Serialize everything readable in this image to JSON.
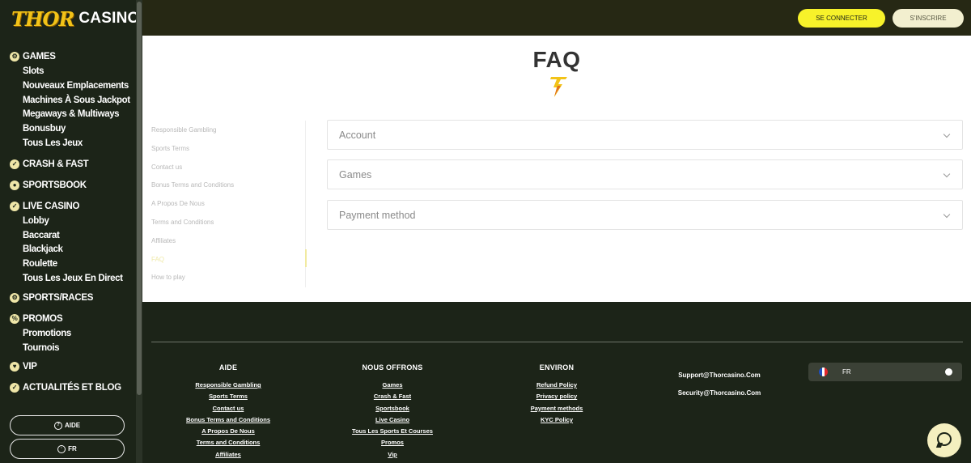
{
  "brand": {
    "thor": "THOR",
    "casino": "CASINO"
  },
  "sidebar": {
    "games": {
      "label": "GAMES",
      "items": [
        "Slots",
        "Nouveaux Emplacements",
        "Machines À Sous Jackpot",
        "Megaways & Multiways",
        "Bonusbuy",
        "Tous Les Jeux"
      ]
    },
    "crash": {
      "label": "CRASH & FAST"
    },
    "sportsbook": {
      "label": "SPORTSBOOK"
    },
    "live": {
      "label": "LIVE CASINO",
      "items": [
        "Lobby",
        "Baccarat",
        "Blackjack",
        "Roulette",
        "Tous Les Jeux En Direct"
      ]
    },
    "sportsraces": {
      "label": "SPORTS/RACES"
    },
    "promos": {
      "label": "PROMOS",
      "items": [
        "Promotions",
        "Tournois"
      ]
    },
    "vip": {
      "label": "VIP"
    },
    "news": {
      "label": "ACTUALITÉS ET BLOG"
    },
    "help_label": "AIDE",
    "lang_label": "FR"
  },
  "topbar": {
    "login_label": "SE CONNECTER",
    "register_label": "S'INSCRIRE"
  },
  "main": {
    "title": "FAQ",
    "menu": [
      "Responsible Gambling",
      "Sports Terms",
      "Contact us",
      "Bonus Terms and Conditions",
      "A Propos De Nous",
      "Terms and Conditions",
      "Affiliates",
      "FAQ",
      "How to play"
    ],
    "accordion": [
      "Account",
      "Games",
      "Payment method"
    ]
  },
  "footer": {
    "aide": {
      "title": "AIDE",
      "links": [
        "Responsible Gambling",
        "Sports Terms",
        "Contact us",
        "Bonus Terms and Conditions",
        "A Propos De Nous",
        "Terms and Conditions",
        "Affiliates"
      ]
    },
    "offrons": {
      "title": "NOUS OFFRONS",
      "links": [
        "Games",
        "Crash & Fast",
        "Sportsbook",
        "Live Casino",
        "Tous Les Sports Et Courses",
        "Promos",
        "Vip"
      ]
    },
    "environ": {
      "title": "ENVIRON",
      "links": [
        "Refund Policy",
        "Privacy policy",
        "Payment methods",
        "KYC Policy"
      ]
    },
    "contact": {
      "support": "Support@Thorcasino.Com",
      "security": "Security@Thorcasino.Com"
    },
    "language": "FR"
  },
  "colors": {
    "accent_yellow": "#f7f22a",
    "dark_bg": "#1c2418",
    "topbar_bg": "#262814"
  },
  "icons": {
    "chat": "chat-icon",
    "flag": "france-flag-icon"
  }
}
